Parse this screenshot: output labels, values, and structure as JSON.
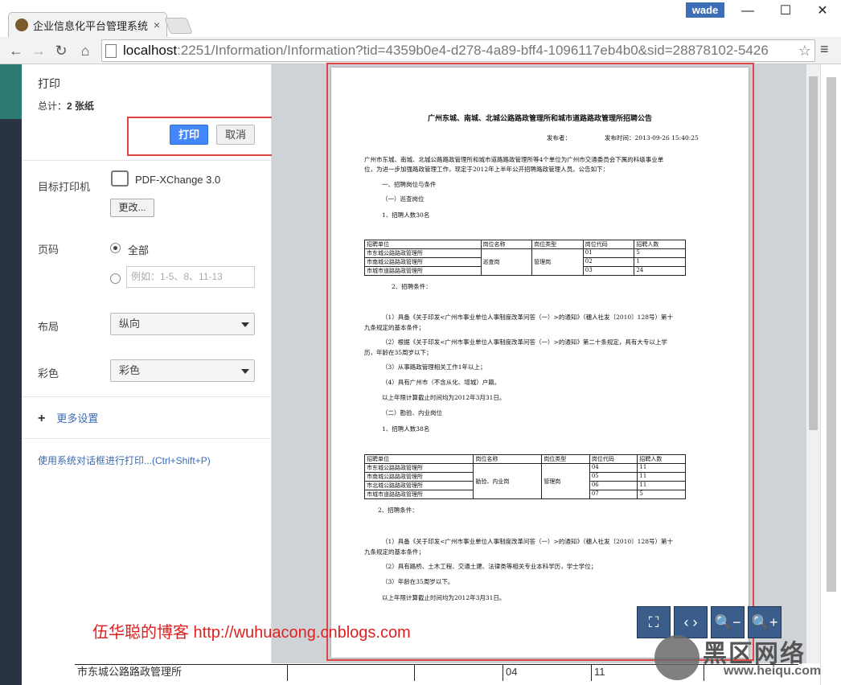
{
  "browser": {
    "tab_title": "企业信息化平台管理系统",
    "tab_close": "×",
    "user": "wade",
    "url_host": "localhost",
    "url_rest": ":2251/Information/Information?tid=4359b0e4-d278-4a89-bff4-1096117eb4b0&sid=28878102-5426",
    "win_min": "—",
    "win_max": "☐",
    "win_close": "✕",
    "back": "←",
    "forward": "→",
    "reload": "↻",
    "home": "⌂",
    "star": "☆",
    "menu": "≡"
  },
  "print": {
    "title": "打印",
    "total_prefix": "总计：",
    "total_value": "2 张纸",
    "print_btn": "打印",
    "cancel_btn": "取消",
    "dest_label": "目标打印机",
    "printer": "PDF-XChange 3.0",
    "change_btn": "更改...",
    "pages_label": "页码",
    "pages_all": "全部",
    "pages_placeholder": "例如：1-5、8、11-13",
    "layout_label": "布局",
    "layout_value": "纵向",
    "color_label": "彩色",
    "color_value": "彩色",
    "more_plus": "+",
    "more_settings": "更多设置",
    "system_dialog": "使用系统对话框进行打印...(Ctrl+Shift+P)"
  },
  "watermark": "伍华聪的博客  http://wuhuacong.cnblogs.com",
  "doc": {
    "title": "广州东城、南城、北城公路路政管理所和城市道路路政管理所招聘公告",
    "publisher": "发布者：",
    "time": "发布时间：2013-09-26 15:40:25",
    "intro1": "广州市东城、南城、北城公路路政管理所和城市道路路政管理所等4个单位为广州市交通委员会下属的科级事业单",
    "intro2": "位，为进一步加强路政管理工作，现定于2012年上半年公开招聘路政管理人员。公告如下：",
    "s1": "一、招聘岗位与条件",
    "s1a": "（一）巡查岗位",
    "s1a1": "1、招聘人数30名",
    "t1": {
      "header": [
        "招聘单位",
        "岗位名称",
        "岗位类型",
        "岗位代码",
        "招聘人数"
      ],
      "units": [
        "市东城公路路政管理所",
        "市南城公路路政管理所",
        "市城市道路路政管理所"
      ],
      "pos": "巡查岗",
      "type": "管理岗",
      "codes": [
        "01",
        "02",
        "03"
      ],
      "counts": [
        "5",
        "1",
        "24"
      ]
    },
    "cond_a": "2、招聘条件：",
    "c1a": "（1）具备《关于印发<广州市事业单位人事制度改革问答（一）>的通知》（穗人社发〔2010〕128号）第十",
    "c1b": "九条规定的基本条件；",
    "c2a": "（2）根据《关于印发<广州市事业单位人事制度改革问答（一）>的通知》第二十条规定，具有大专以上学",
    "c2b": "历，年龄在35周岁以下；",
    "c3": "（3）从事路政管理相关工作1年以上；",
    "c4": "（4）具有广州市（不含从化、增城）户籍。",
    "c5": "以上年限计算截止时间均为2012年3月31日。",
    "s1b": "（二）勘验、内业岗位",
    "s1b1": "1、招聘人数38名",
    "t2": {
      "header": [
        "招聘单位",
        "岗位名称",
        "岗位类型",
        "岗位代码",
        "招聘人数"
      ],
      "units": [
        "市东城公路路政管理所",
        "市南城公路路政管理所",
        "市北城公路路政管理所",
        "市城市道路路政管理所"
      ],
      "pos": "勘验、内业岗",
      "type": "管理岗",
      "codes": [
        "04",
        "05",
        "06",
        "07"
      ],
      "counts": [
        "11",
        "11",
        "11",
        "5"
      ]
    },
    "cond_b": "2、招聘条件：",
    "d1a": "（1）具备《关于印发<广州市事业单位人事制度改革问答（一）>的通知》（穗人社发〔2010〕128号）第十",
    "d1b": "九条规定的基本条件；",
    "d2": "（2）具有路桥、土木工程、交通土建、法律类等相关专业本科学历，学士学位；",
    "d3": "（3）年龄在35周岁以下。",
    "d4": "以上年限计算截止时间均为2012年3月31日。"
  },
  "zoom": {
    "fit": "⛶",
    "width": "‹ ›",
    "zoom_out": "🔍−",
    "zoom_in": "🔍+"
  },
  "bottom_row": {
    "unit": "市东城公路路政管理所",
    "code": "04",
    "count": "11"
  },
  "logo": {
    "name": "黑区网络",
    "site": "www.heiqu.com"
  }
}
